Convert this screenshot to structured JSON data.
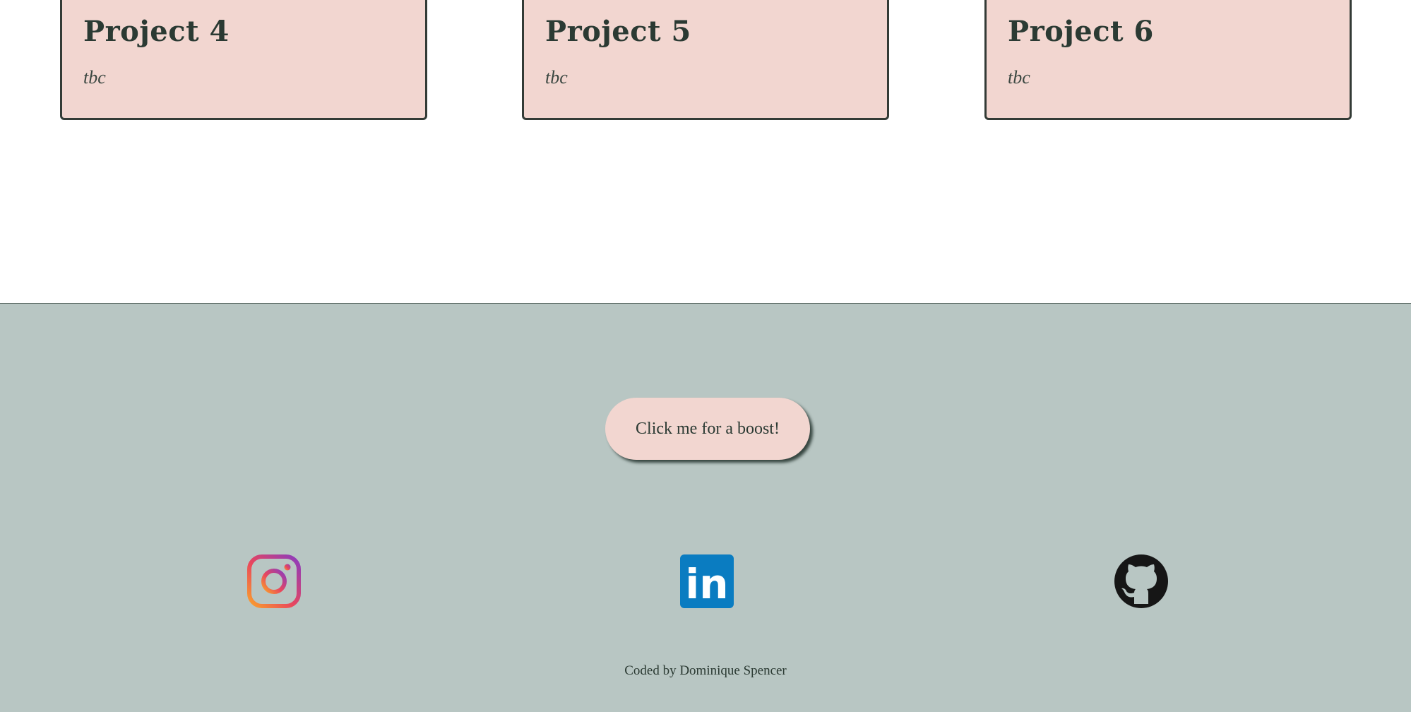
{
  "projects": [
    {
      "title": "Project 4",
      "description": "tbc"
    },
    {
      "title": "Project 5",
      "description": "tbc"
    },
    {
      "title": "Project 6",
      "description": "tbc"
    }
  ],
  "footer": {
    "boost_label": "Click me for a boost!",
    "social": [
      {
        "name": "Instagram",
        "icon": "instagram-icon"
      },
      {
        "name": "LinkedIn",
        "icon": "linkedin-icon",
        "glyph": "in"
      },
      {
        "name": "GitHub",
        "icon": "github-icon"
      }
    ],
    "credit": "Coded by Dominique Spencer"
  },
  "colors": {
    "card_background": "#f2d6d0",
    "card_border": "#333b36",
    "footer_background": "#b8c6c3",
    "text": "#2b3a33",
    "linkedin_blue": "#0a7cc1"
  }
}
